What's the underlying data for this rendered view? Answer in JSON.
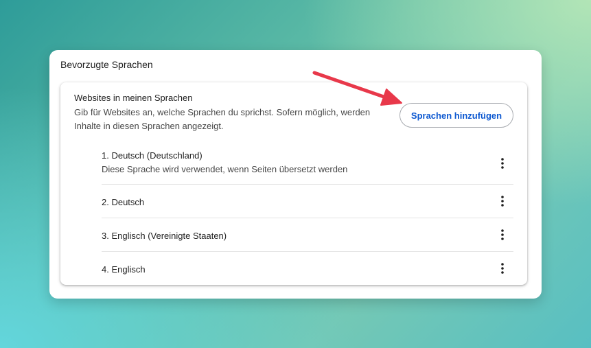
{
  "outer_card": {
    "title": "Bevorzugte Sprachen"
  },
  "section": {
    "title": "Websites in meinen Sprachen",
    "description": "Gib für Websites an, welche Sprachen du sprichst. Sofern möglich, werden Inhalte in diesen Sprachen angezeigt.",
    "add_button_label": "Sprachen hinzufügen"
  },
  "languages": [
    {
      "label": "1. Deutsch (Deutschland)",
      "sublabel": "Diese Sprache wird verwendet, wenn Seiten übersetzt werden"
    },
    {
      "label": "2. Deutsch"
    },
    {
      "label": "3. Englisch (Vereinigte Staaten)"
    },
    {
      "label": "4. Englisch"
    }
  ],
  "icons": {
    "more": "more-vert-icon",
    "annotation": "red-arrow"
  },
  "colors": {
    "accent": "#0b57d0",
    "arrow": "#e8384a",
    "text_primary": "#1f1f1f",
    "text_secondary": "#474747",
    "divider": "#e3e3e3"
  }
}
